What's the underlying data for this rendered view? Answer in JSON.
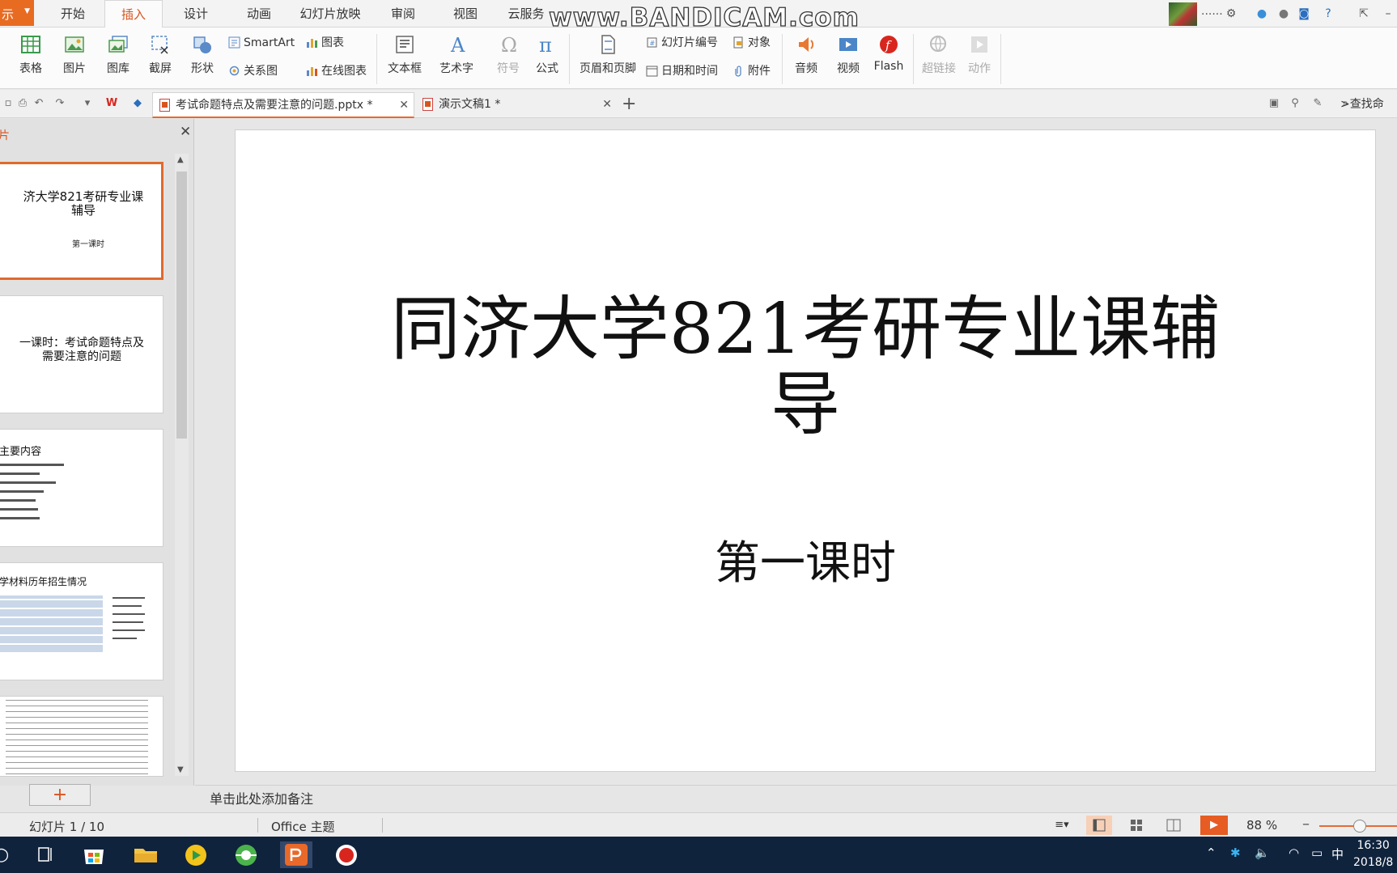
{
  "app": {
    "label": "示"
  },
  "ribbon_tabs": [
    "开始",
    "插入",
    "设计",
    "动画",
    "幻灯片放映",
    "审阅",
    "视图",
    "云服务"
  ],
  "watermark": "www.BANDICAM.com",
  "user": {
    "name": "......"
  },
  "ribbon": {
    "table": "表格",
    "picture": "图片",
    "gallery": "图库",
    "screenshot": "截屏",
    "shape": "形状",
    "smartart": "SmartArt",
    "relation": "关系图",
    "chart": "图表",
    "online_chart": "在线图表",
    "textbox": "文本框",
    "wordart": "艺术字",
    "symbol": "符号",
    "formula": "公式",
    "header_footer": "页眉和页脚",
    "slide_number": "幻灯片编号",
    "date_time": "日期和时间",
    "object": "对象",
    "attachment": "附件",
    "audio": "音频",
    "video": "视频",
    "flash": "Flash",
    "hyperlink": "超链接",
    "action": "动作"
  },
  "doc_tabs": [
    {
      "title": "考试命题特点及需要注意的问题.pptx *"
    },
    {
      "title": "演示文稿1 *"
    }
  ],
  "search": {
    "label": ">查找命"
  },
  "left_pane": {
    "label": "片",
    "slides": [
      {
        "title": "济大学821考研专业课辅导",
        "sub": "第一课时"
      },
      {
        "title": "一课时：考试命题特点及需要注意的问题"
      },
      {
        "title": "主要内容"
      },
      {
        "title": "学材料历年招生情况"
      },
      {
        "title": ""
      }
    ]
  },
  "slide": {
    "title": "同济大学821考研专业课辅导",
    "subtitle": "第一课时"
  },
  "notes": {
    "placeholder": "单击此处添加备注"
  },
  "status": {
    "slide_info": "幻灯片 1 / 10",
    "theme": "Office 主题",
    "zoom": "88 %"
  },
  "taskbar": {
    "time": "16:30",
    "date": "2018/8",
    "ime": "中"
  }
}
